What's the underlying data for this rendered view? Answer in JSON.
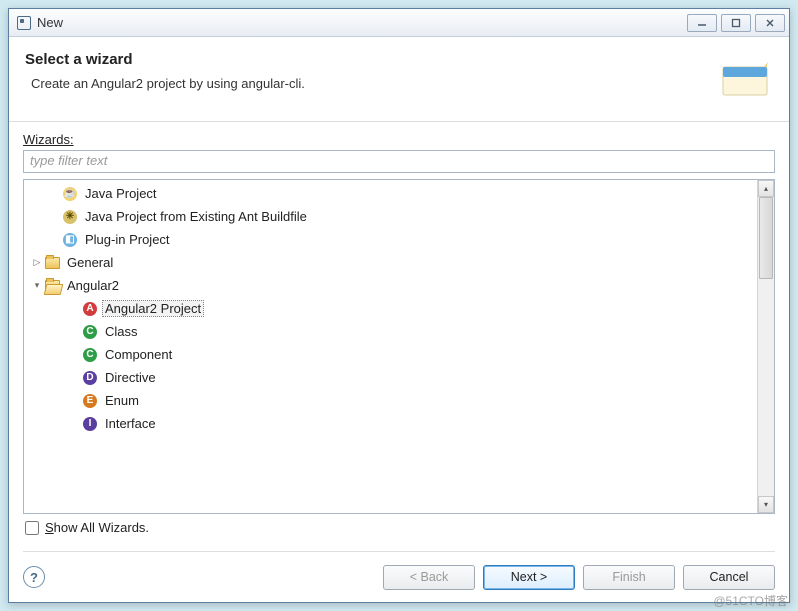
{
  "window": {
    "title": "New"
  },
  "header": {
    "title": "Select a wizard",
    "subtitle": "Create an Angular2 project by using angular-cli."
  },
  "filter": {
    "label": "Wizards:",
    "placeholder": "type filter text"
  },
  "tree": [
    {
      "level": 1,
      "expand": "",
      "icon": "java-sun",
      "label": "Java Project",
      "name": "tree-item-java-project"
    },
    {
      "level": 1,
      "expand": "",
      "icon": "ant",
      "label": "Java Project from Existing Ant Buildfile",
      "name": "tree-item-java-ant"
    },
    {
      "level": 1,
      "expand": "",
      "icon": "plugin",
      "label": "Plug-in Project",
      "name": "tree-item-plugin"
    },
    {
      "level": 0,
      "expand": "▷",
      "icon": "folder",
      "label": "General",
      "name": "tree-item-general"
    },
    {
      "level": 0,
      "expand": "▾",
      "icon": "folder-open",
      "label": "Angular2",
      "name": "tree-item-angular2"
    },
    {
      "level": 2,
      "expand": "",
      "icon": "A-red",
      "label": "Angular2 Project",
      "name": "tree-item-angular2-project",
      "selected": true
    },
    {
      "level": 2,
      "expand": "",
      "icon": "C-green",
      "label": "Class",
      "name": "tree-item-class"
    },
    {
      "level": 2,
      "expand": "",
      "icon": "C-green",
      "label": "Component",
      "name": "tree-item-component"
    },
    {
      "level": 2,
      "expand": "",
      "icon": "D-purple",
      "label": "Directive",
      "name": "tree-item-directive"
    },
    {
      "level": 2,
      "expand": "",
      "icon": "E-orange",
      "label": "Enum",
      "name": "tree-item-enum"
    },
    {
      "level": 2,
      "expand": "",
      "icon": "I-purple",
      "label": "Interface",
      "name": "tree-item-interface"
    }
  ],
  "showAll": {
    "label": "Show All Wizards."
  },
  "buttons": {
    "back": "< Back",
    "next": "Next >",
    "finish": "Finish",
    "cancel": "Cancel"
  },
  "watermark": "@51CTO博客"
}
